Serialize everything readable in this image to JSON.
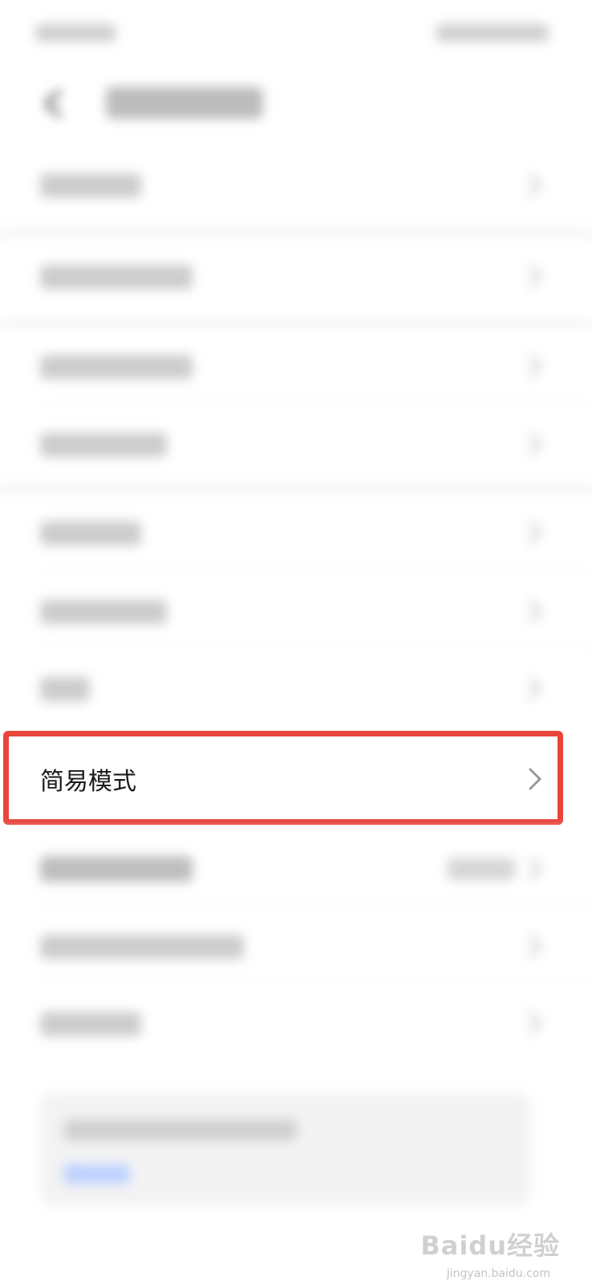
{
  "status_bar": {
    "left_text": "",
    "right_text": ""
  },
  "header": {
    "title": ""
  },
  "settings_items": [
    {
      "label": "",
      "value": ""
    },
    {
      "label": "",
      "value": ""
    },
    {
      "label": "",
      "value": ""
    },
    {
      "label": "",
      "value": ""
    },
    {
      "label": "",
      "value": ""
    },
    {
      "label": "",
      "value": ""
    },
    {
      "label": "",
      "value": ""
    },
    {
      "label": "简易模式",
      "value": "",
      "highlighted": true
    },
    {
      "label": "",
      "value": ""
    },
    {
      "label": "",
      "value": ""
    },
    {
      "label": "",
      "value": ""
    }
  ],
  "card": {
    "text": "",
    "link": ""
  },
  "watermark": {
    "brand": "Baidu经验",
    "url": "jingyan.baidu.com"
  },
  "colors": {
    "highlight_border": "#e8463b",
    "chevron": "#9a9a9a",
    "background": "#ffffff",
    "section_gap": "#f4f4f4",
    "link": "#3a7bff"
  },
  "icons": {
    "back": "arrow-left-icon",
    "chevron": "chevron-right-icon"
  }
}
